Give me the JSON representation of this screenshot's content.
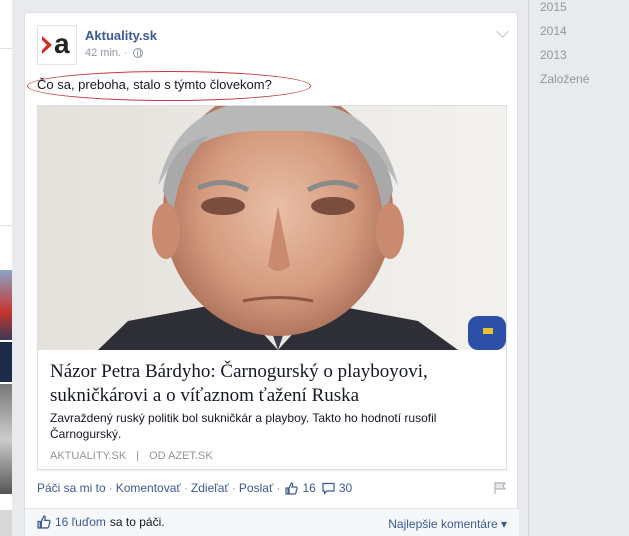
{
  "post": {
    "page_name": "Aktuality.sk",
    "time": "42 min.",
    "separator": "·",
    "logo_letter": "a",
    "text": "Čo sa, preboha, stalo s týmto človekom?"
  },
  "attachment": {
    "title": "Názor Petra Bárdyho: Čarnogurský o playboyovi, sukničkárovi a o víťaznom ťažení Ruska",
    "description": "Zavraždený ruský politik bol sukničkár a playboy. Takto ho hodnotí rusofil Čarnogurský.",
    "source": "AKTUALITY.SK",
    "source_sep": "|",
    "via": "OD AZET.SK"
  },
  "actions": {
    "like": "Páči sa mi to",
    "comment": "Komentovať",
    "share": "Zdieľať",
    "post": "Poslať",
    "dot": "·",
    "like_count": "16",
    "comment_count": "30"
  },
  "likes": {
    "people": "16 ľuďom",
    "suffix": "sa to páči.",
    "sort": "Najlepšie komentáre ▾"
  },
  "timeline": {
    "years": [
      "2015",
      "2014",
      "2013",
      "Založené"
    ]
  },
  "colors": {
    "link": "#3b5998",
    "brand_red": "#d52b1e",
    "annotation": "#c43a3a"
  }
}
